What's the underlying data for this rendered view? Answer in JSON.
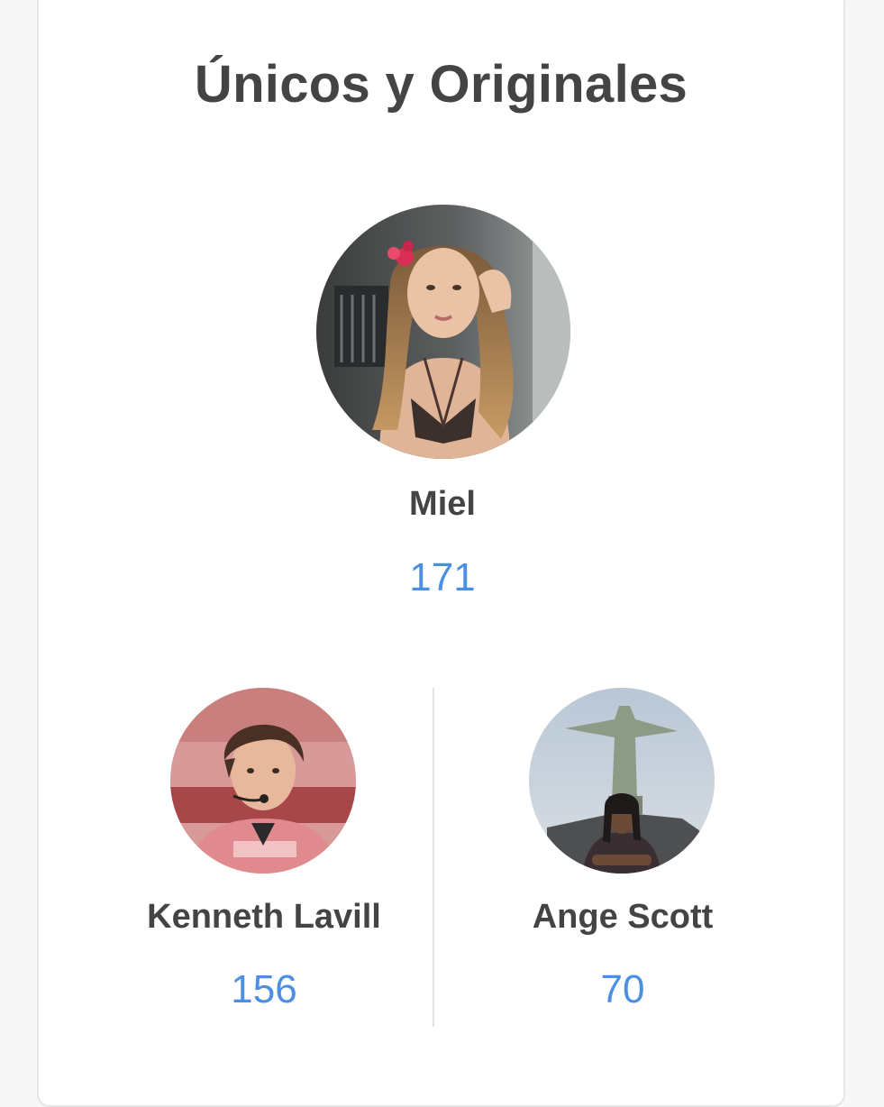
{
  "section": {
    "title": "Únicos y Originales"
  },
  "leader": {
    "name": "Miel",
    "count": "171"
  },
  "runners": [
    {
      "name": "Kenneth Lavill",
      "count": "156"
    },
    {
      "name": "Ange Scott",
      "count": "70"
    }
  ],
  "colors": {
    "count_accent": "#4a8fe3",
    "text": "#444444",
    "card_background": "#ffffff",
    "page_background": "#f7f7f7"
  }
}
